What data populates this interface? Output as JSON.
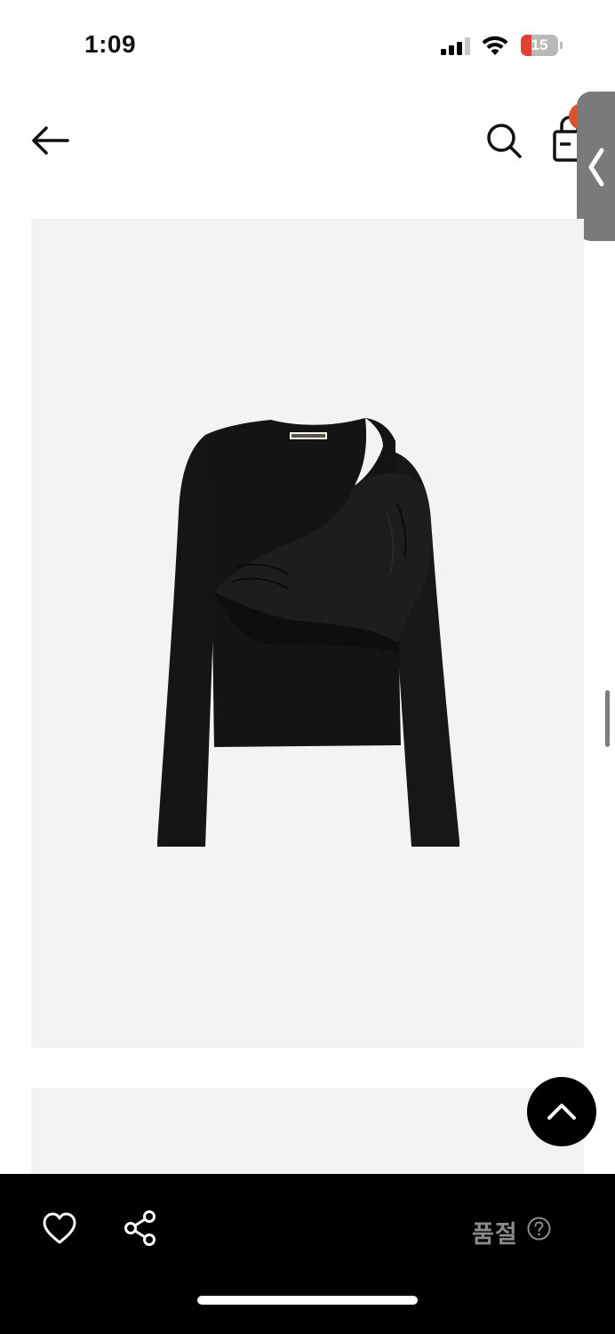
{
  "status_bar": {
    "time": "1:09",
    "battery_level": "15",
    "battery_color": "#e0422f"
  },
  "nav": {
    "back_icon": "arrow-left-icon",
    "search_icon": "search-icon",
    "bag_icon": "shopping-bag-icon",
    "badge_color": "#e0512b"
  },
  "side_handle": {
    "icon": "chevron-left-icon"
  },
  "product": {
    "image_background": "#f3f3f3",
    "garment_label": "IMSILENCE"
  },
  "scroll_top": {
    "icon": "chevron-up-icon"
  },
  "bottom_bar": {
    "wishlist_icon": "heart-icon",
    "share_icon": "share-icon",
    "status_label": "품절",
    "help_icon": "question-circle-icon"
  }
}
